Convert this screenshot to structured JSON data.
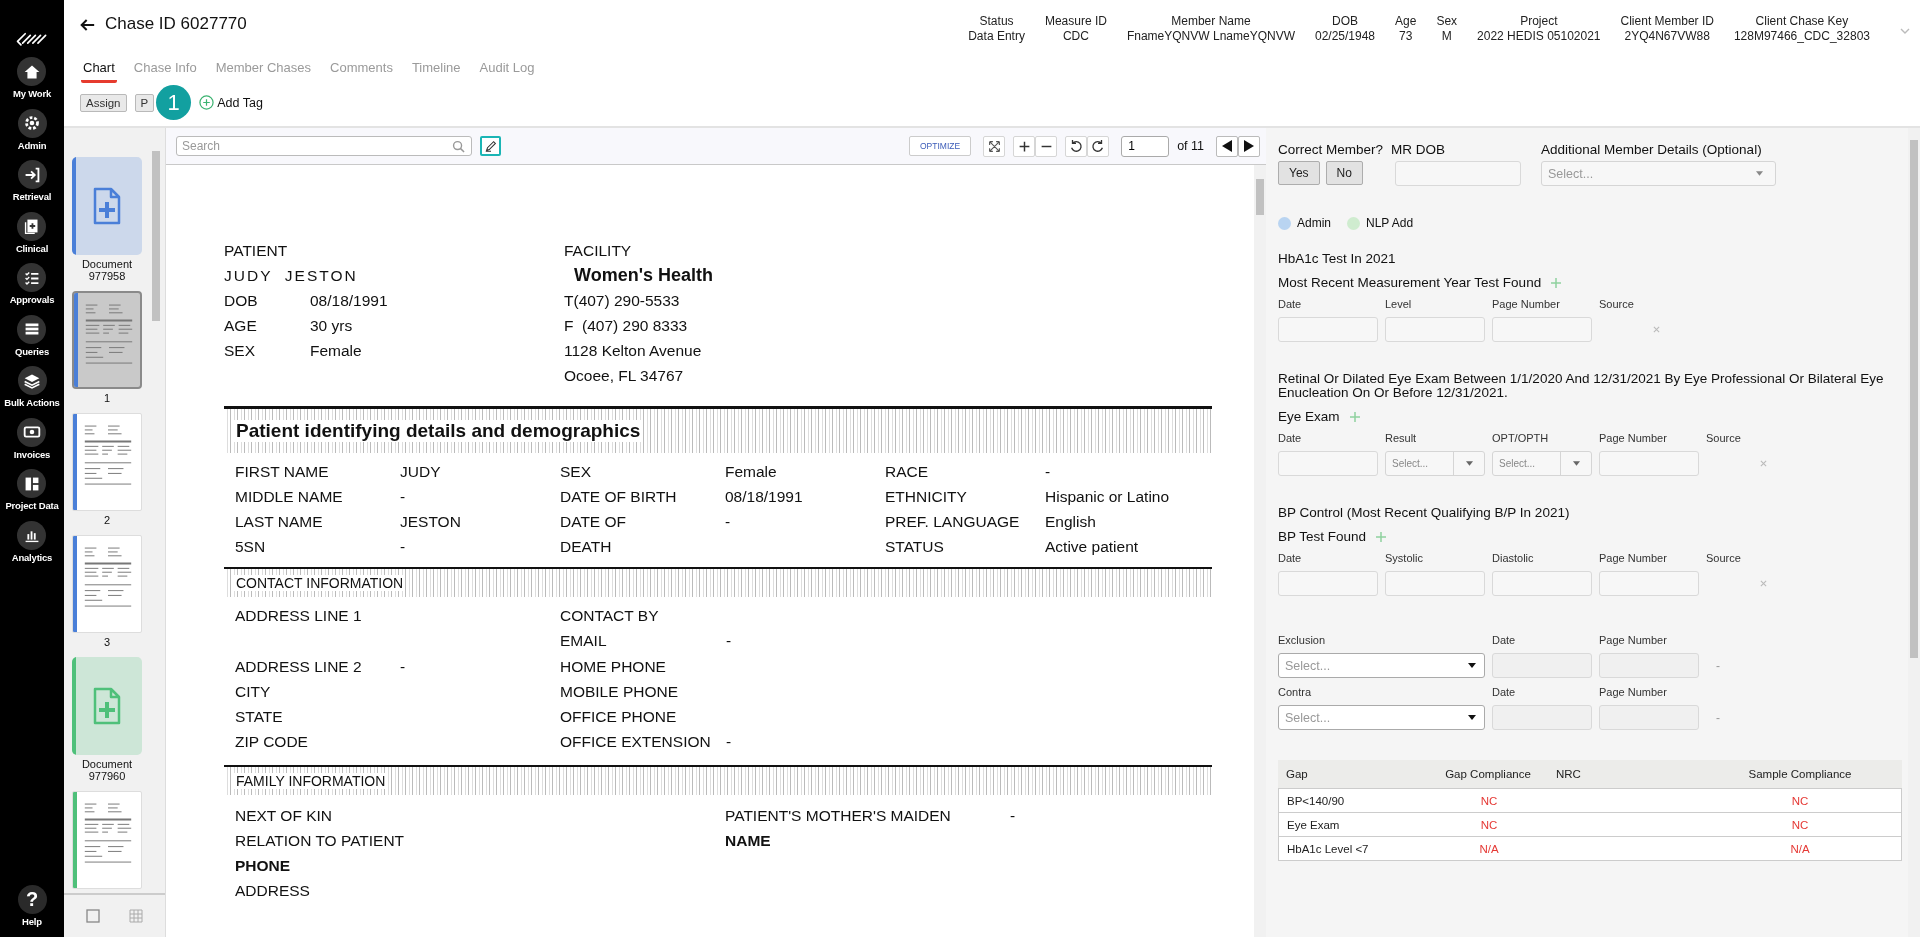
{
  "nav": {
    "items": [
      {
        "label": "My Work"
      },
      {
        "label": "Admin"
      },
      {
        "label": "Retrieval"
      },
      {
        "label": "Clinical"
      },
      {
        "label": "Approvals"
      },
      {
        "label": "Queries"
      },
      {
        "label": "Bulk Actions"
      },
      {
        "label": "Invoices"
      },
      {
        "label": "Project Data"
      },
      {
        "label": "Analytics"
      }
    ],
    "help": {
      "label": "Help",
      "glyph": "?"
    }
  },
  "header": {
    "title": "Chase ID 6027770",
    "info": [
      {
        "label": "Status",
        "value": "Data Entry"
      },
      {
        "label": "Measure ID",
        "value": "CDC"
      },
      {
        "label": "Member Name",
        "value": "FnameYQNVW LnameYQNVW"
      },
      {
        "label": "DOB",
        "value": "02/25/1948"
      },
      {
        "label": "Age",
        "value": "73"
      },
      {
        "label": "Sex",
        "value": "M"
      },
      {
        "label": "Project",
        "value": "2022 HEDIS 05102021"
      },
      {
        "label": "Client Member ID",
        "value": "2YQ4N67VW88"
      },
      {
        "label": "Client Chase Key",
        "value": "128M97466_CDC_32803"
      }
    ]
  },
  "tabs": [
    {
      "label": "Chart",
      "selected": true
    },
    {
      "label": "Chase Info",
      "selected": false
    },
    {
      "label": "Member Chases",
      "selected": false
    },
    {
      "label": "Comments",
      "selected": false
    },
    {
      "label": "Timeline",
      "selected": false
    },
    {
      "label": "Audit Log",
      "selected": false
    }
  ],
  "actions": {
    "buttons": [
      "Assign",
      "P"
    ],
    "badge": "1",
    "add_tag": "Add Tag"
  },
  "thumbnails": [
    {
      "kind": "document",
      "label": "Document 977958",
      "color": "#4a7fd8"
    },
    {
      "kind": "page",
      "label": "1",
      "color": "#4a7fd8",
      "selected": true
    },
    {
      "kind": "page",
      "label": "2",
      "color": "#4a7fd8",
      "selected": false
    },
    {
      "kind": "page",
      "label": "3",
      "color": "#4a7fd8",
      "selected": false
    },
    {
      "kind": "document",
      "label": "Document 977960",
      "color": "#4fc07a"
    },
    {
      "kind": "page",
      "color": "#4fc07a",
      "selected": false
    }
  ],
  "viewer": {
    "search": {
      "placeholder": "Search"
    },
    "optimize": "OPTIMIZE",
    "page": "1",
    "page_count": "of 11"
  },
  "document": {
    "patient": {
      "heading": "PATIENT",
      "name": "JUDY  JESTON",
      "fields": [
        {
          "label": "DOB",
          "value": "08/18/1991"
        },
        {
          "label": "AGE",
          "value": "30 yrs"
        },
        {
          "label": "SEX",
          "value": "Female"
        }
      ]
    },
    "facility": {
      "heading": "FACILITY",
      "name": "Women's Health",
      "lines": [
        "T(407) 290-5533",
        "F  (407) 290 8333",
        "1128 Kelton Avenue",
        "Ocoee, FL 34767"
      ]
    },
    "sections": [
      {
        "kind": "demographics",
        "title": "Patient identifying details and demographics",
        "rows": [
          [
            {
              "label": "FIRST NAME",
              "value": "JUDY"
            },
            {
              "label": "SEX",
              "value": "Female"
            },
            {
              "label": "RACE",
              "value": "-"
            }
          ],
          [
            {
              "label": "MIDDLE NAME",
              "value": "-"
            },
            {
              "label": "DATE OF BIRTH",
              "value": "08/18/1991"
            },
            {
              "label": "ETHNICITY",
              "value": "Hispanic or Latino"
            }
          ],
          [
            {
              "label": "LAST NAME",
              "value": "JESTON"
            },
            {
              "label": "DATE OF",
              "value": "-"
            },
            {
              "label": "PREF. LANGUAGE",
              "value": "English"
            }
          ],
          [
            {
              "label": "5SN",
              "value": "-"
            },
            {
              "label": "DEATH"
            },
            {
              "label": "STATUS",
              "value": "Active patient"
            }
          ]
        ]
      },
      {
        "kind": "contact",
        "title": "CONTACT INFORMATION",
        "rows": [
          [
            {
              "label": "ADDRESS LINE 1"
            },
            {
              "label": "CONTACT BY"
            }
          ],
          [
            {},
            {
              "label": "EMAIL",
              "value": "-"
            }
          ],
          [
            {
              "label": "ADDRESS LINE 2",
              "value": "-"
            },
            {
              "label": "HOME PHONE"
            }
          ],
          [
            {
              "label": "CITY"
            },
            {
              "label": "MOBILE PHONE"
            }
          ],
          [
            {
              "label": "STATE"
            },
            {
              "label": "OFFICE PHONE"
            }
          ],
          [
            {
              "label": "ZIP CODE"
            },
            {
              "label": "OFFICE EXTENSION",
              "value": "-"
            }
          ]
        ]
      },
      {
        "kind": "family",
        "title": "FAMILY INFORMATION",
        "rows": [
          [
            {
              "label": "NEXT OF KIN"
            },
            {
              "label": "PATIENT'S MOTHER'S MAIDEN",
              "value": "-"
            }
          ],
          [
            {
              "label": "RELATION TO PATIENT"
            },
            {
              "label": "NAME",
              "bold": true
            }
          ],
          [
            {
              "label": "PHONE",
              "bold": true
            }
          ],
          [
            {
              "label": "ADDRESS"
            }
          ]
        ]
      }
    ]
  },
  "panel": {
    "member": {
      "question": "Correct Member?",
      "buttons": [
        "Yes",
        "No"
      ],
      "mr_dob": "MR DOB",
      "details": {
        "label": "Additional Member Details (Optional)",
        "placeholder": "Select..."
      }
    },
    "legend": [
      {
        "label": "Admin",
        "color": "#b9d4f1"
      },
      {
        "label": "NLP Add",
        "color": "#cfeccf"
      }
    ],
    "measures": [
      {
        "title": "HbA1c Test In 2021",
        "subtitle": "Most Recent Measurement Year Test Found",
        "fields": [
          {
            "label": "Date",
            "kind": "input"
          },
          {
            "label": "Level",
            "kind": "input"
          },
          {
            "label": "Page Number",
            "kind": "input"
          },
          {
            "label": "Source",
            "kind": "blank"
          }
        ]
      },
      {
        "title": "Retinal Or Dilated Eye Exam Between 1/1/2020 And 12/31/2021 By Eye Professional Or Bilateral Eye Enucleation On Or Before 12/31/2021.",
        "subtitle": "Eye Exam",
        "fields": [
          {
            "label": "Date",
            "kind": "input"
          },
          {
            "label": "Result",
            "kind": "select",
            "placeholder": "Select..."
          },
          {
            "label": "OPT/OPTH",
            "kind": "select",
            "placeholder": "Select..."
          },
          {
            "label": "Page Number",
            "kind": "input"
          },
          {
            "label": "Source",
            "kind": "blank"
          }
        ]
      },
      {
        "title": "BP Control (Most Recent Qualifying B/P In 2021)",
        "subtitle": "BP Test Found",
        "fields": [
          {
            "label": "Date",
            "kind": "input"
          },
          {
            "label": "Systolic",
            "kind": "input"
          },
          {
            "label": "Diastolic",
            "kind": "input"
          },
          {
            "label": "Page Number",
            "kind": "input"
          },
          {
            "label": "Source",
            "kind": "blank"
          }
        ]
      }
    ],
    "exclusions": [
      {
        "label": "Exclusion",
        "placeholder": "Select...",
        "date": "Date",
        "page": "Page Number",
        "dash": "-"
      },
      {
        "label": "Contra",
        "placeholder": "Select...",
        "date": "Date",
        "page": "Page Number",
        "dash": "-"
      }
    ],
    "table": {
      "columns": [
        "Gap",
        "Gap Compliance",
        "NRC",
        "Sample Compliance"
      ],
      "rows": [
        {
          "gap": "BP<140/90",
          "gap_compliance": "NC",
          "sample_compliance": "NC"
        },
        {
          "gap": "Eye Exam",
          "gap_compliance": "NC",
          "sample_compliance": "NC"
        },
        {
          "gap": "HbA1c Level <7",
          "gap_compliance": "N/A",
          "sample_compliance": "N/A"
        }
      ]
    }
  }
}
